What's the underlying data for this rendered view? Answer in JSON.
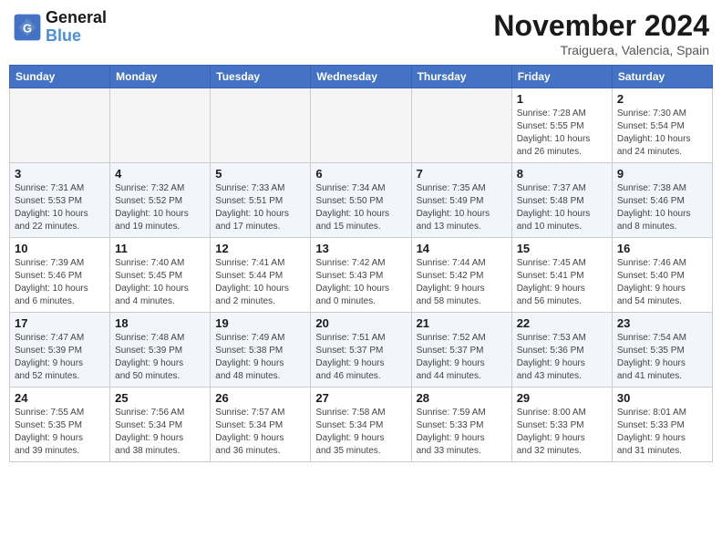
{
  "header": {
    "logo_line1": "General",
    "logo_line2": "Blue",
    "month_year": "November 2024",
    "location": "Traiguera, Valencia, Spain"
  },
  "weekdays": [
    "Sunday",
    "Monday",
    "Tuesday",
    "Wednesday",
    "Thursday",
    "Friday",
    "Saturday"
  ],
  "weeks": [
    [
      {
        "day": "",
        "info": ""
      },
      {
        "day": "",
        "info": ""
      },
      {
        "day": "",
        "info": ""
      },
      {
        "day": "",
        "info": ""
      },
      {
        "day": "",
        "info": ""
      },
      {
        "day": "1",
        "info": "Sunrise: 7:28 AM\nSunset: 5:55 PM\nDaylight: 10 hours\nand 26 minutes."
      },
      {
        "day": "2",
        "info": "Sunrise: 7:30 AM\nSunset: 5:54 PM\nDaylight: 10 hours\nand 24 minutes."
      }
    ],
    [
      {
        "day": "3",
        "info": "Sunrise: 7:31 AM\nSunset: 5:53 PM\nDaylight: 10 hours\nand 22 minutes."
      },
      {
        "day": "4",
        "info": "Sunrise: 7:32 AM\nSunset: 5:52 PM\nDaylight: 10 hours\nand 19 minutes."
      },
      {
        "day": "5",
        "info": "Sunrise: 7:33 AM\nSunset: 5:51 PM\nDaylight: 10 hours\nand 17 minutes."
      },
      {
        "day": "6",
        "info": "Sunrise: 7:34 AM\nSunset: 5:50 PM\nDaylight: 10 hours\nand 15 minutes."
      },
      {
        "day": "7",
        "info": "Sunrise: 7:35 AM\nSunset: 5:49 PM\nDaylight: 10 hours\nand 13 minutes."
      },
      {
        "day": "8",
        "info": "Sunrise: 7:37 AM\nSunset: 5:48 PM\nDaylight: 10 hours\nand 10 minutes."
      },
      {
        "day": "9",
        "info": "Sunrise: 7:38 AM\nSunset: 5:46 PM\nDaylight: 10 hours\nand 8 minutes."
      }
    ],
    [
      {
        "day": "10",
        "info": "Sunrise: 7:39 AM\nSunset: 5:46 PM\nDaylight: 10 hours\nand 6 minutes."
      },
      {
        "day": "11",
        "info": "Sunrise: 7:40 AM\nSunset: 5:45 PM\nDaylight: 10 hours\nand 4 minutes."
      },
      {
        "day": "12",
        "info": "Sunrise: 7:41 AM\nSunset: 5:44 PM\nDaylight: 10 hours\nand 2 minutes."
      },
      {
        "day": "13",
        "info": "Sunrise: 7:42 AM\nSunset: 5:43 PM\nDaylight: 10 hours\nand 0 minutes."
      },
      {
        "day": "14",
        "info": "Sunrise: 7:44 AM\nSunset: 5:42 PM\nDaylight: 9 hours\nand 58 minutes."
      },
      {
        "day": "15",
        "info": "Sunrise: 7:45 AM\nSunset: 5:41 PM\nDaylight: 9 hours\nand 56 minutes."
      },
      {
        "day": "16",
        "info": "Sunrise: 7:46 AM\nSunset: 5:40 PM\nDaylight: 9 hours\nand 54 minutes."
      }
    ],
    [
      {
        "day": "17",
        "info": "Sunrise: 7:47 AM\nSunset: 5:39 PM\nDaylight: 9 hours\nand 52 minutes."
      },
      {
        "day": "18",
        "info": "Sunrise: 7:48 AM\nSunset: 5:39 PM\nDaylight: 9 hours\nand 50 minutes."
      },
      {
        "day": "19",
        "info": "Sunrise: 7:49 AM\nSunset: 5:38 PM\nDaylight: 9 hours\nand 48 minutes."
      },
      {
        "day": "20",
        "info": "Sunrise: 7:51 AM\nSunset: 5:37 PM\nDaylight: 9 hours\nand 46 minutes."
      },
      {
        "day": "21",
        "info": "Sunrise: 7:52 AM\nSunset: 5:37 PM\nDaylight: 9 hours\nand 44 minutes."
      },
      {
        "day": "22",
        "info": "Sunrise: 7:53 AM\nSunset: 5:36 PM\nDaylight: 9 hours\nand 43 minutes."
      },
      {
        "day": "23",
        "info": "Sunrise: 7:54 AM\nSunset: 5:35 PM\nDaylight: 9 hours\nand 41 minutes."
      }
    ],
    [
      {
        "day": "24",
        "info": "Sunrise: 7:55 AM\nSunset: 5:35 PM\nDaylight: 9 hours\nand 39 minutes."
      },
      {
        "day": "25",
        "info": "Sunrise: 7:56 AM\nSunset: 5:34 PM\nDaylight: 9 hours\nand 38 minutes."
      },
      {
        "day": "26",
        "info": "Sunrise: 7:57 AM\nSunset: 5:34 PM\nDaylight: 9 hours\nand 36 minutes."
      },
      {
        "day": "27",
        "info": "Sunrise: 7:58 AM\nSunset: 5:34 PM\nDaylight: 9 hours\nand 35 minutes."
      },
      {
        "day": "28",
        "info": "Sunrise: 7:59 AM\nSunset: 5:33 PM\nDaylight: 9 hours\nand 33 minutes."
      },
      {
        "day": "29",
        "info": "Sunrise: 8:00 AM\nSunset: 5:33 PM\nDaylight: 9 hours\nand 32 minutes."
      },
      {
        "day": "30",
        "info": "Sunrise: 8:01 AM\nSunset: 5:33 PM\nDaylight: 9 hours\nand 31 minutes."
      }
    ]
  ]
}
